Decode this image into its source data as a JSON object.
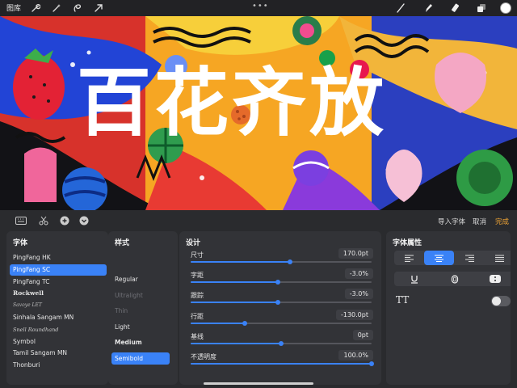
{
  "toolbar": {
    "gallery_label": "图库",
    "left_icons": [
      "wrench-icon",
      "magic-wand-icon",
      "selection-icon",
      "transform-arrow-icon"
    ],
    "right_icons": [
      "brush-icon",
      "smudge-icon",
      "eraser-icon",
      "layers-icon",
      "color-swatch-icon"
    ],
    "current_color": "#ffffff"
  },
  "canvas": {
    "text": "百花齐放"
  },
  "panel": {
    "left_icons": [
      "keyboard-icon",
      "scissors-icon",
      "plus-circle-icon",
      "chevron-down-circle-icon"
    ],
    "import_font_label": "导入字体",
    "cancel_label": "取消",
    "done_label": "完成",
    "accent_color": "#3a82f7",
    "done_color": "#f0a434"
  },
  "fonts": {
    "title": "字体",
    "items": [
      "PingFang HK",
      "PingFang SC",
      "PingFang TC",
      "Rockwell",
      "Savoye LET",
      "Sinhala Sangam MN",
      "Snell Roundhand",
      "Symbol",
      "Tamil Sangam MN",
      "Thonburi"
    ],
    "selected": "PingFang SC"
  },
  "styles": {
    "title": "样式",
    "items": [
      "Regular",
      "Ultralight",
      "Thin",
      "Light",
      "Medium",
      "Semibold"
    ],
    "selected": "Semibold"
  },
  "design": {
    "title": "设计",
    "rows": [
      {
        "label": "尺寸",
        "value": "170.0pt",
        "fraction": 0.55
      },
      {
        "label": "字距",
        "value": "-3.0%",
        "fraction": 0.48
      },
      {
        "label": "跟踪",
        "value": "-3.0%",
        "fraction": 0.48
      },
      {
        "label": "行距",
        "value": "-130.0pt",
        "fraction": 0.3
      },
      {
        "label": "基线",
        "value": "0pt",
        "fraction": 0.5
      },
      {
        "label": "不透明度",
        "value": "100.0%",
        "fraction": 1.0
      }
    ]
  },
  "attributes": {
    "title": "字体属性",
    "alignment_options": [
      "align-left-icon",
      "align-center-icon",
      "align-right-icon",
      "align-justify-icon"
    ],
    "selected_alignment": "align-center-icon",
    "style_options": [
      "underline-icon",
      "outline-icon",
      "vertical-text-icon"
    ],
    "caps_label": "TT",
    "caps_enabled": false
  }
}
